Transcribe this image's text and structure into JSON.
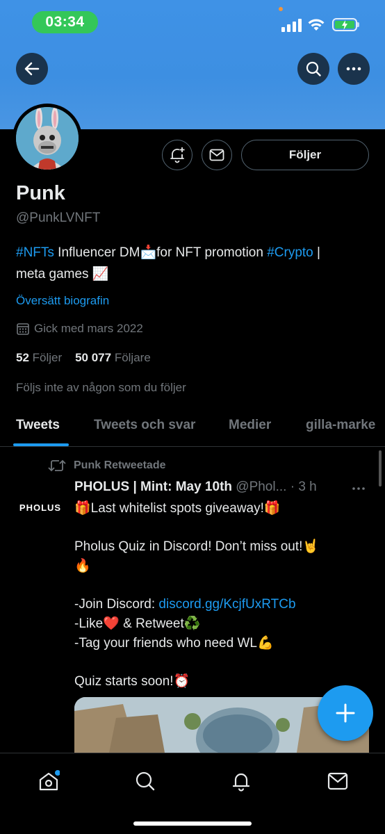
{
  "status_bar": {
    "time": "03:34"
  },
  "profile": {
    "name": "Punk",
    "handle": "@PunkLVNFT",
    "bio": {
      "tag1": "#NFTs",
      "text1": " Influencer DM",
      "emoji1": "📩",
      "text2": "for NFT promotion ",
      "tag2": "#Crypto",
      "text3": " |",
      "text4": "meta games ",
      "emoji2": "📈"
    },
    "translate_label": "Översätt biografin",
    "joined": "Gick med mars 2022",
    "following_count": "52",
    "following_label": "Följer",
    "followers_count": "50 077",
    "followers_label": "Följare",
    "not_followed_text": "Följs inte av någon som du följer",
    "follow_button_label": "Följer"
  },
  "tabs": [
    {
      "label": "Tweets",
      "active": true
    },
    {
      "label": "Tweets och svar",
      "active": false
    },
    {
      "label": "Medier",
      "active": false
    },
    {
      "label": "gilla-marke",
      "active": false
    }
  ],
  "tweet": {
    "retweet_label": "Punk Retweetade",
    "avatar_text": "PHOLUS",
    "author": "PHOLUS | Mint: May 10th",
    "handle_time": " @Phol... · 3 h",
    "line1": "🎁Last whitelist spots giveaway!🎁",
    "line2": "Pholus Quiz in Discord! Don’t miss out!🤘",
    "line3": "🔥",
    "line4_prefix": "-Join Discord: ",
    "line4_link": "discord.gg/KcjfUxRTCb",
    "line5": "-Like❤️ & Retweet♻️",
    "line6": "-Tag your friends who need WL💪",
    "line7": "Quiz starts soon!⏰"
  },
  "colors": {
    "accent": "#1d9bf0",
    "banner": "#3f92e6",
    "status_green": "#34c759",
    "text_primary": "#e7e9ea",
    "text_secondary": "#71767b"
  },
  "icons": {
    "back": "arrow-left-icon",
    "search": "search-icon",
    "more": "more-horizontal-icon",
    "notify": "bell-plus-icon",
    "message": "envelope-icon",
    "calendar": "calendar-icon",
    "retweet": "retweet-icon",
    "compose": "plus-icon",
    "nav_home": "home-icon",
    "nav_search": "search-icon",
    "nav_notifications": "bell-icon",
    "nav_messages": "envelope-icon"
  }
}
